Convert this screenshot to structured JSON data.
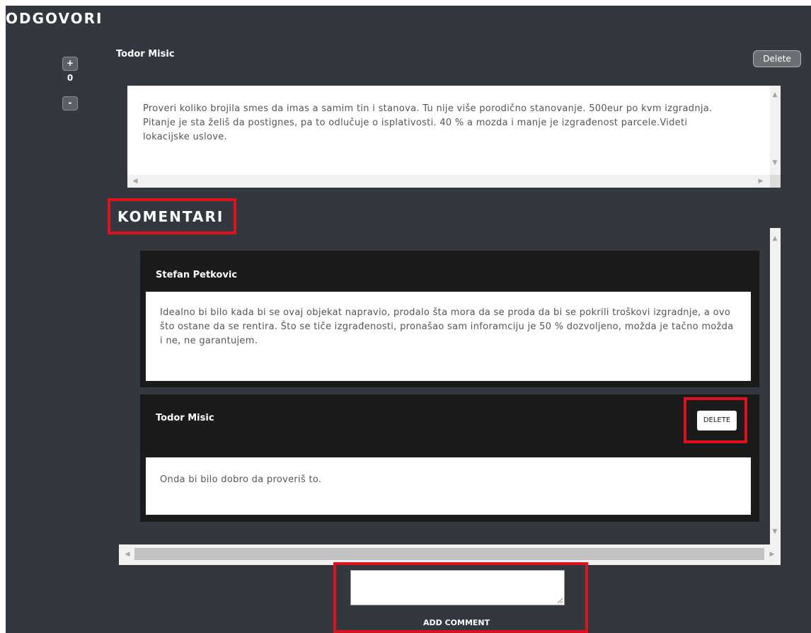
{
  "page": {
    "title": "ODGOVORI"
  },
  "answer": {
    "author": "Todor Misic",
    "delete_label": "Delete",
    "vote_up": "+",
    "vote_down": "-",
    "score": "0",
    "text": "Proveri koliko brojila smes da imas a samim tin i stanova. Tu nije više porodično stanovanje. 500eur po kvm izgradnja. Pitanje je sta želiš da postignes, pa to odlučuje o isplativosti. 40 % a mozda i manje je izgrađenost parcele.Videti lokacijske uslove."
  },
  "comments_section": {
    "title": "KOMENTARI",
    "comments": [
      {
        "author": "Stefan Petkovic",
        "text": "Idealno bi bilo kada bi se ovaj objekat napravio, prodalo šta mora da se proda da bi se pokrili troškovi izgradnje, a ovo što ostane da se rentira. Što se tiče izgrađenosti, pronašao sam inforamciju je 50 % dozvoljeno, možda je tačno možda i ne, ne garantujem."
      },
      {
        "author": "Todor Misic",
        "delete_label": "DELETE",
        "text": "Onda bi bilo dobro da proveriš to."
      }
    ]
  },
  "new_comment": {
    "value": "",
    "submit_label": "ADD COMMENT"
  },
  "icons": {
    "scroll_up": "triangle-up",
    "scroll_down": "triangle-down",
    "scroll_left": "triangle-left",
    "scroll_right": "triangle-right",
    "resize": "resize-grip"
  },
  "colors": {
    "background": "#323740",
    "highlight": "#e0111d",
    "card": "#1b1b1b"
  }
}
